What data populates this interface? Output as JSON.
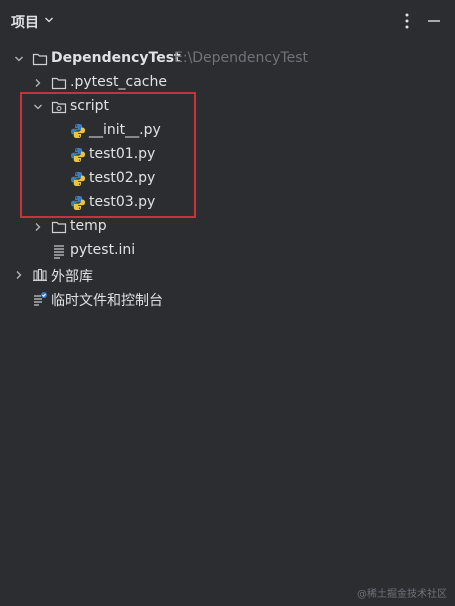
{
  "header": {
    "title": "项目"
  },
  "tree": {
    "root": {
      "label": "DependencyTest",
      "path": "E:\\DependencyTest"
    },
    "pytest_cache": {
      "label": ".pytest_cache"
    },
    "script": {
      "label": "script",
      "files": [
        {
          "label": "__init__.py"
        },
        {
          "label": "test01.py"
        },
        {
          "label": "test02.py"
        },
        {
          "label": "test03.py"
        }
      ]
    },
    "temp": {
      "label": "temp"
    },
    "pytest_ini": {
      "label": "pytest.ini"
    },
    "external_libraries": {
      "label": "外部库"
    },
    "scratches": {
      "label": "临时文件和控制台"
    }
  },
  "watermark": "@稀土掘金技术社区",
  "colors": {
    "background": "#2b2d30",
    "text": "#dfe1e5",
    "muted": "#6f737a",
    "highlight_border": "#c8323a",
    "python_blue": "#3b7bbf",
    "python_yellow": "#f0c33c"
  }
}
